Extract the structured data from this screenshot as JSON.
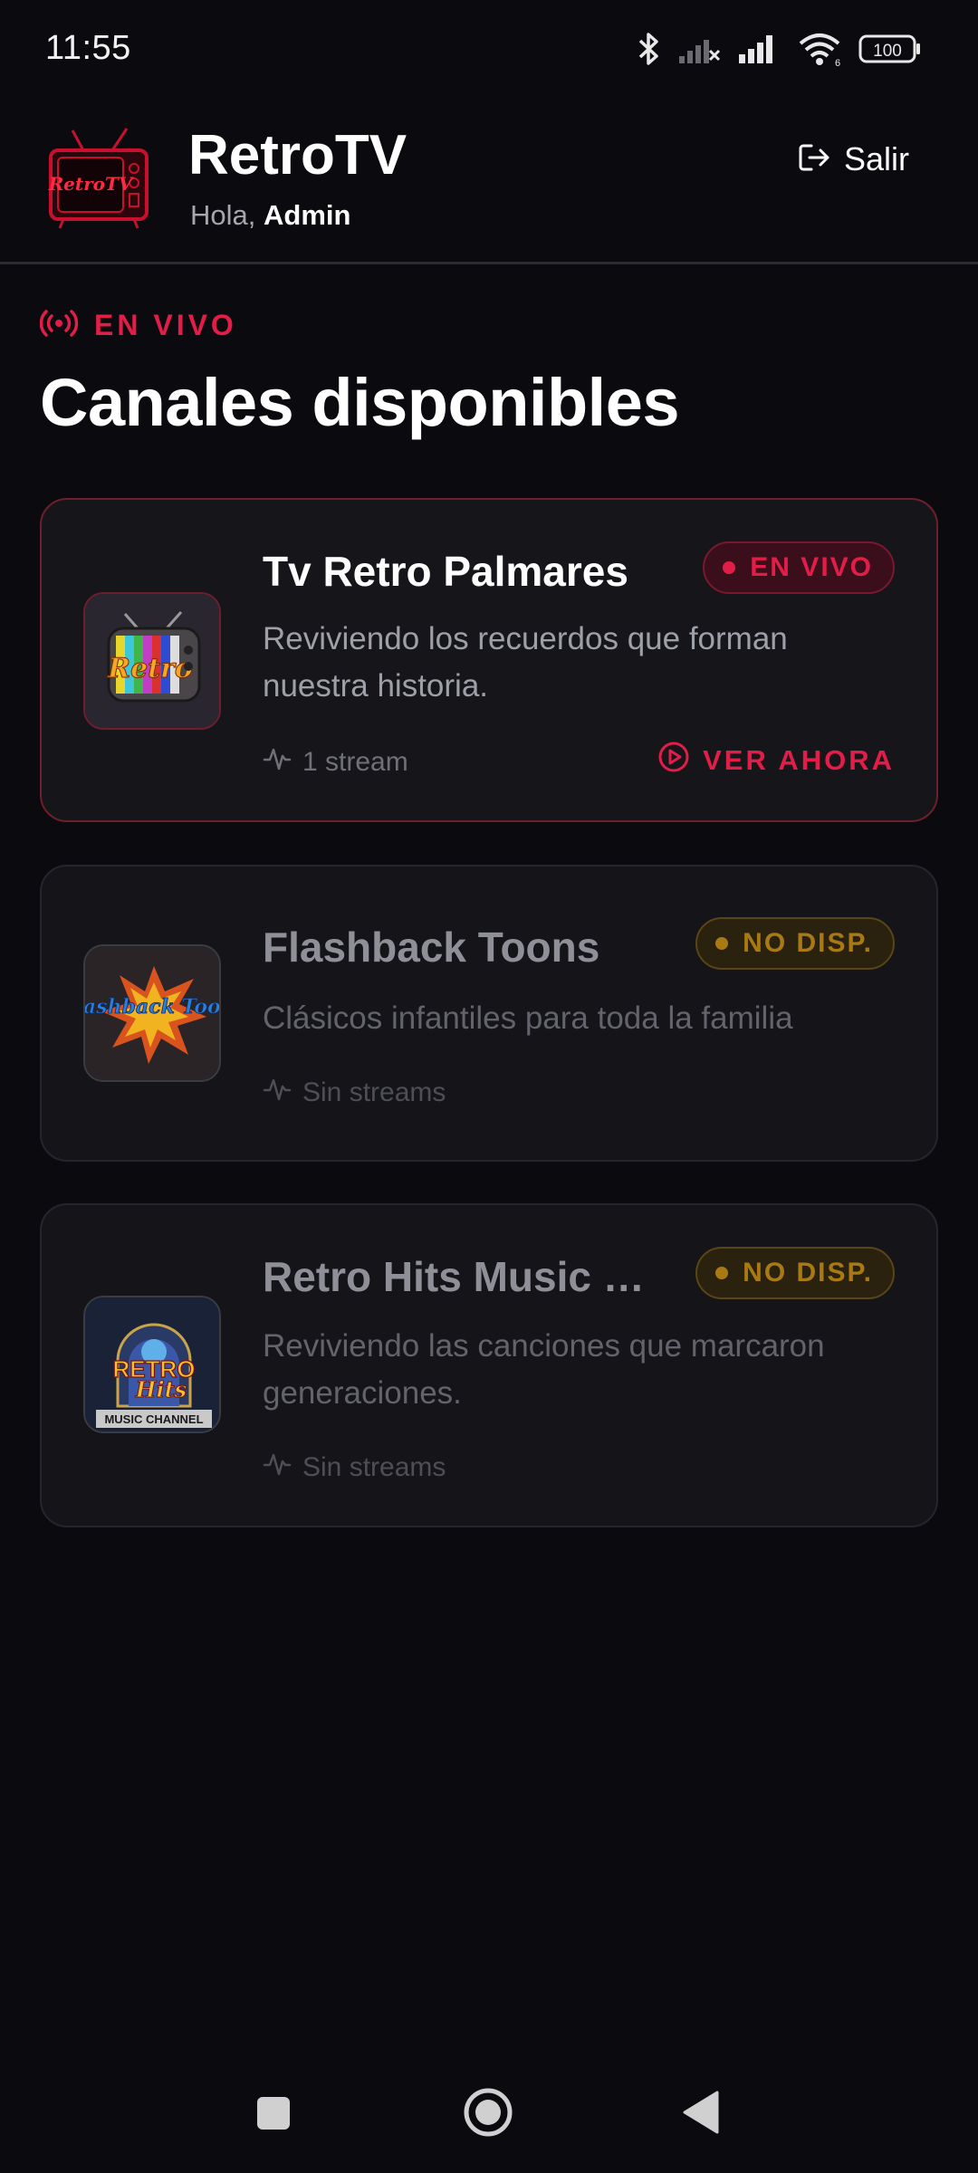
{
  "status_bar": {
    "time": "11:55",
    "battery": "100",
    "icons": [
      "bluetooth-icon",
      "no-signal-icon",
      "signal-icon",
      "wifi-icon",
      "battery-icon"
    ]
  },
  "header": {
    "app_title": "RetroTV",
    "greeting_prefix": "Hola,",
    "user_name": "Admin",
    "logout_label": "Salir",
    "logo_text": "RetroTV"
  },
  "section": {
    "live_label": "EN VIVO",
    "title": "Canales disponibles"
  },
  "channels": [
    {
      "name": "Tv Retro Palmares",
      "description": "Reviviendo los recuerdos que forman nuestra historia.",
      "streams": "1 stream",
      "status": "EN VIVO",
      "action": "VER AHORA",
      "thumb_text": "Retro"
    },
    {
      "name": "Flashback Toons",
      "description": "Clásicos infantiles para toda la familia",
      "streams": "Sin streams",
      "status": "NO DISP.",
      "thumb_text": "Flashback Toons"
    },
    {
      "name": "Retro Hits Music C...",
      "description": "Reviviendo las canciones que marcaron generaciones.",
      "streams": "Sin streams",
      "status": "NO DISP.",
      "thumb_text_1": "RETRO",
      "thumb_text_2": "Hits",
      "thumb_text_3": "MUSIC CHANNEL"
    }
  ],
  "colors": {
    "background": "#0b0b0f",
    "card": "#141419",
    "accent_live": "#e11d48",
    "accent_unavailable": "#a97a14"
  }
}
